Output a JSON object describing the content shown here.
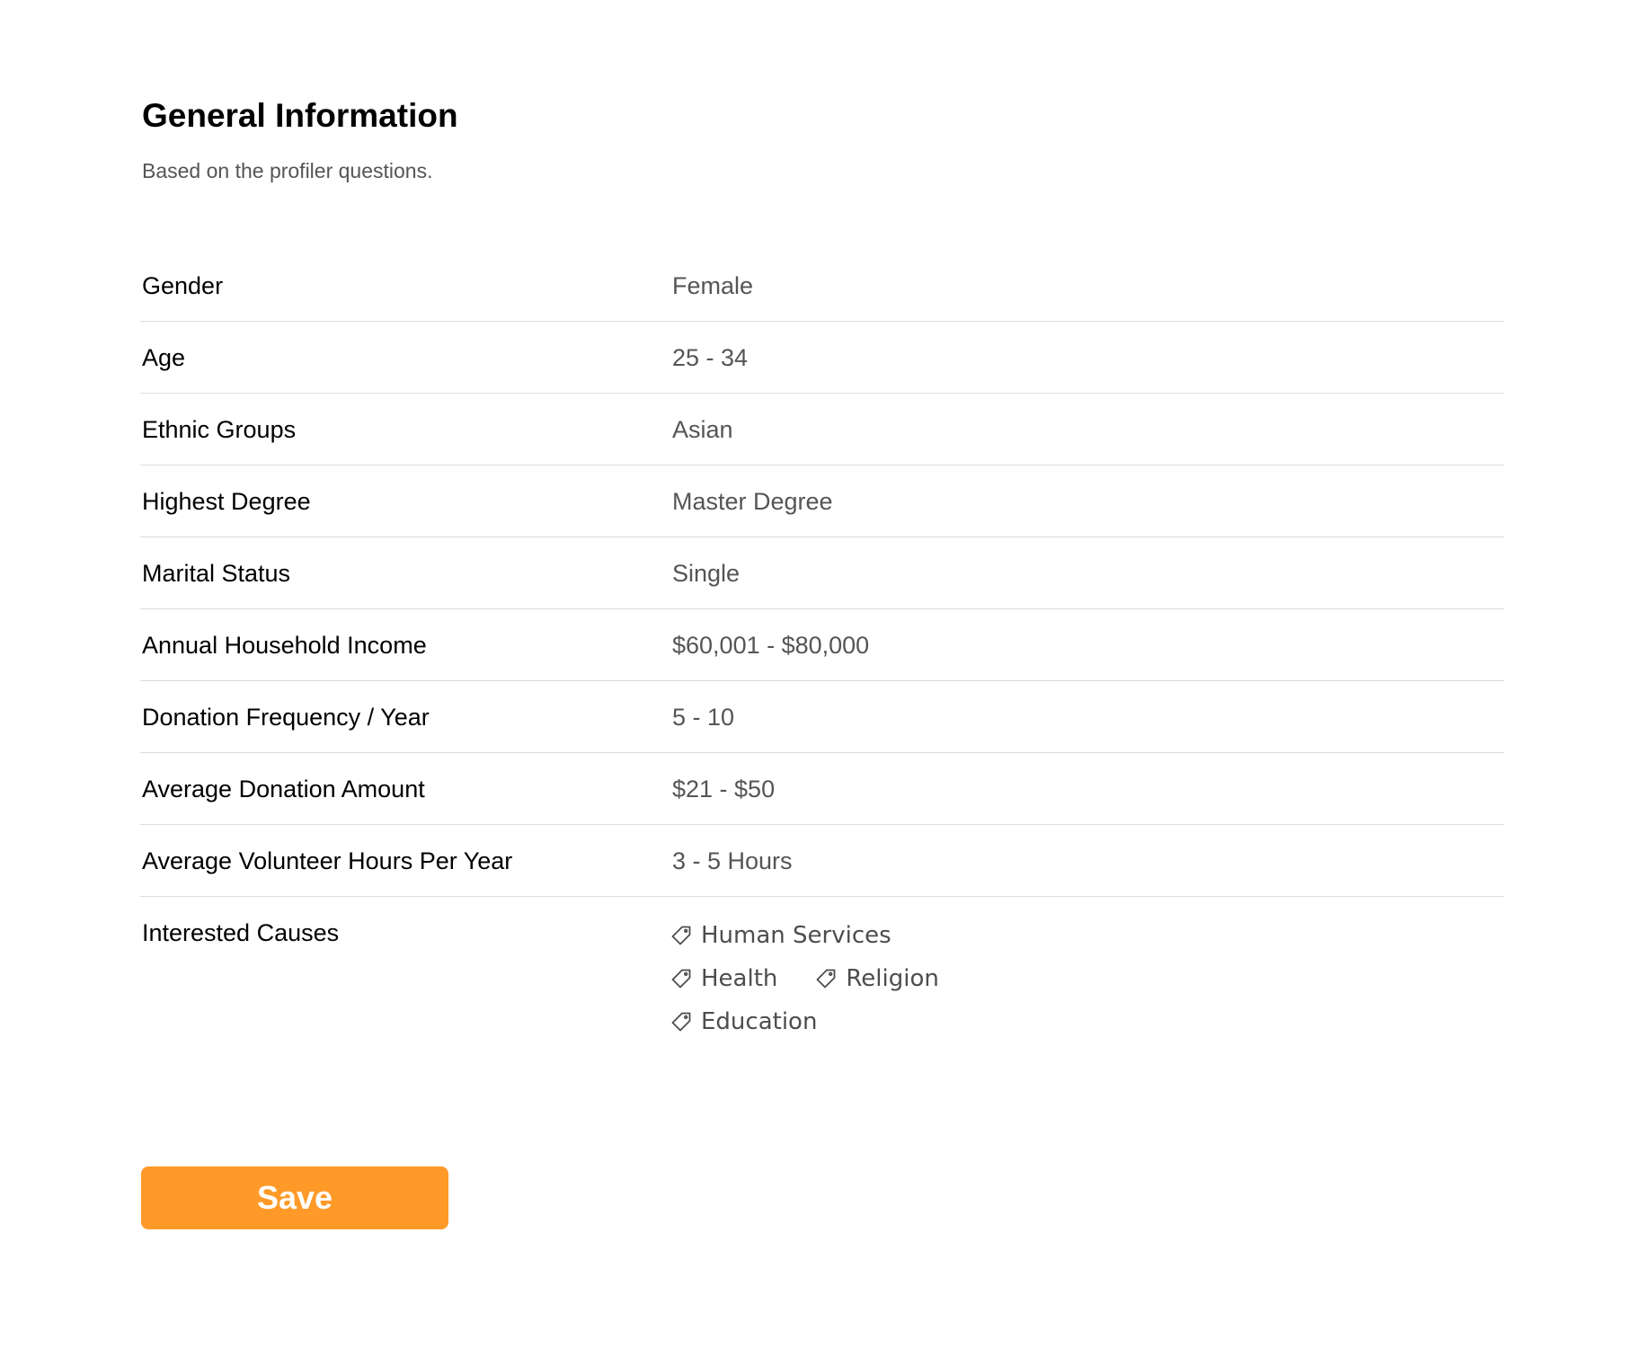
{
  "header": {
    "title": "General Information",
    "subtitle": "Based on the profiler questions."
  },
  "rows": [
    {
      "label": "Gender",
      "value": "Female"
    },
    {
      "label": "Age",
      "value": "25 - 34"
    },
    {
      "label": "Ethnic Groups",
      "value": "Asian"
    },
    {
      "label": "Highest Degree",
      "value": "Master Degree"
    },
    {
      "label": "Marital Status",
      "value": "Single"
    },
    {
      "label": "Annual Household Income",
      "value": "$60,001 - $80,000"
    },
    {
      "label": "Donation Frequency / Year",
      "value": "5 - 10"
    },
    {
      "label": "Average Donation Amount",
      "value": "$21 - $50"
    },
    {
      "label": "Average Volunteer Hours Per Year",
      "value": "3 - 5 Hours"
    }
  ],
  "causes": {
    "label": "Interested Causes",
    "tags": [
      "Human Services",
      "Health",
      "Religion",
      "Education"
    ],
    "icon": "tag-icon"
  },
  "actions": {
    "save_label": "Save"
  },
  "colors": {
    "accent": "#ff9a28",
    "divider": "#dcdcdc",
    "value_text": "#555555"
  }
}
